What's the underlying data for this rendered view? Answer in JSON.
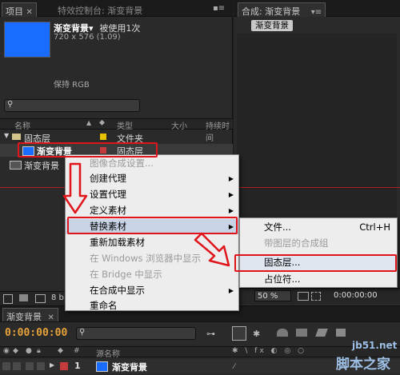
{
  "project_panel": {
    "tab_label": "项目",
    "effect_tab_label": "特效控制台: 渐变背景",
    "item_name": "渐变背景▾",
    "usage": "被使用1次",
    "dimensions": "720 x 576 (1.09)",
    "color_mode": "保持 RGB",
    "columns": {
      "name": "名称",
      "type": "类型",
      "size": "大小",
      "duration": "持续时间"
    },
    "rows": [
      {
        "name": "固态层",
        "type": "文件夹"
      },
      {
        "name": "渐变背景",
        "type": "固态层"
      },
      {
        "name": "渐变背景",
        "type": ""
      }
    ],
    "bottom_badge": "8 b"
  },
  "comp_panel": {
    "tab_label": "合成: 渐变背景",
    "sub_tab_label": "渐变背景",
    "zoom": "50 %",
    "timecode": "0:00:00:00"
  },
  "context_menu": {
    "items": [
      {
        "label": "图像合成设置...",
        "disabled": true,
        "submenu": false
      },
      {
        "label": "创建代理",
        "disabled": false,
        "submenu": true
      },
      {
        "label": "设置代理",
        "disabled": false,
        "submenu": true
      },
      {
        "label": "定义素材",
        "disabled": false,
        "submenu": true
      },
      {
        "label": "替换素材",
        "disabled": false,
        "submenu": true
      },
      {
        "label": "重新加载素材",
        "disabled": false,
        "submenu": false
      },
      {
        "label": "在 Windows 浏览器中显示",
        "disabled": true,
        "submenu": false
      },
      {
        "label": "在 Bridge 中显示",
        "disabled": true,
        "submenu": false
      },
      {
        "label": "在合成中显示",
        "disabled": false,
        "submenu": true
      },
      {
        "label": "重命名",
        "disabled": false,
        "submenu": false
      }
    ]
  },
  "submenu": {
    "items": [
      {
        "label": "文件...",
        "shortcut": "Ctrl+H",
        "disabled": false
      },
      {
        "label": "带图层的合成组",
        "shortcut": "",
        "disabled": true
      },
      {
        "label": "固态层...",
        "shortcut": "",
        "disabled": false
      },
      {
        "label": "占位符...",
        "shortcut": "",
        "disabled": false
      }
    ]
  },
  "timeline": {
    "tab_label": "渐变背景",
    "timecode": "0:00:00:00",
    "source_name_header": "源名称",
    "layer_number": "1",
    "layer_name": "渐变背景"
  },
  "watermark": {
    "site": "jb51.net",
    "name": "脚本之家"
  },
  "colors": {
    "accent_blue": "#1a6cff",
    "highlight_red": "#e0141b",
    "timecode_orange": "#e8a33a"
  }
}
